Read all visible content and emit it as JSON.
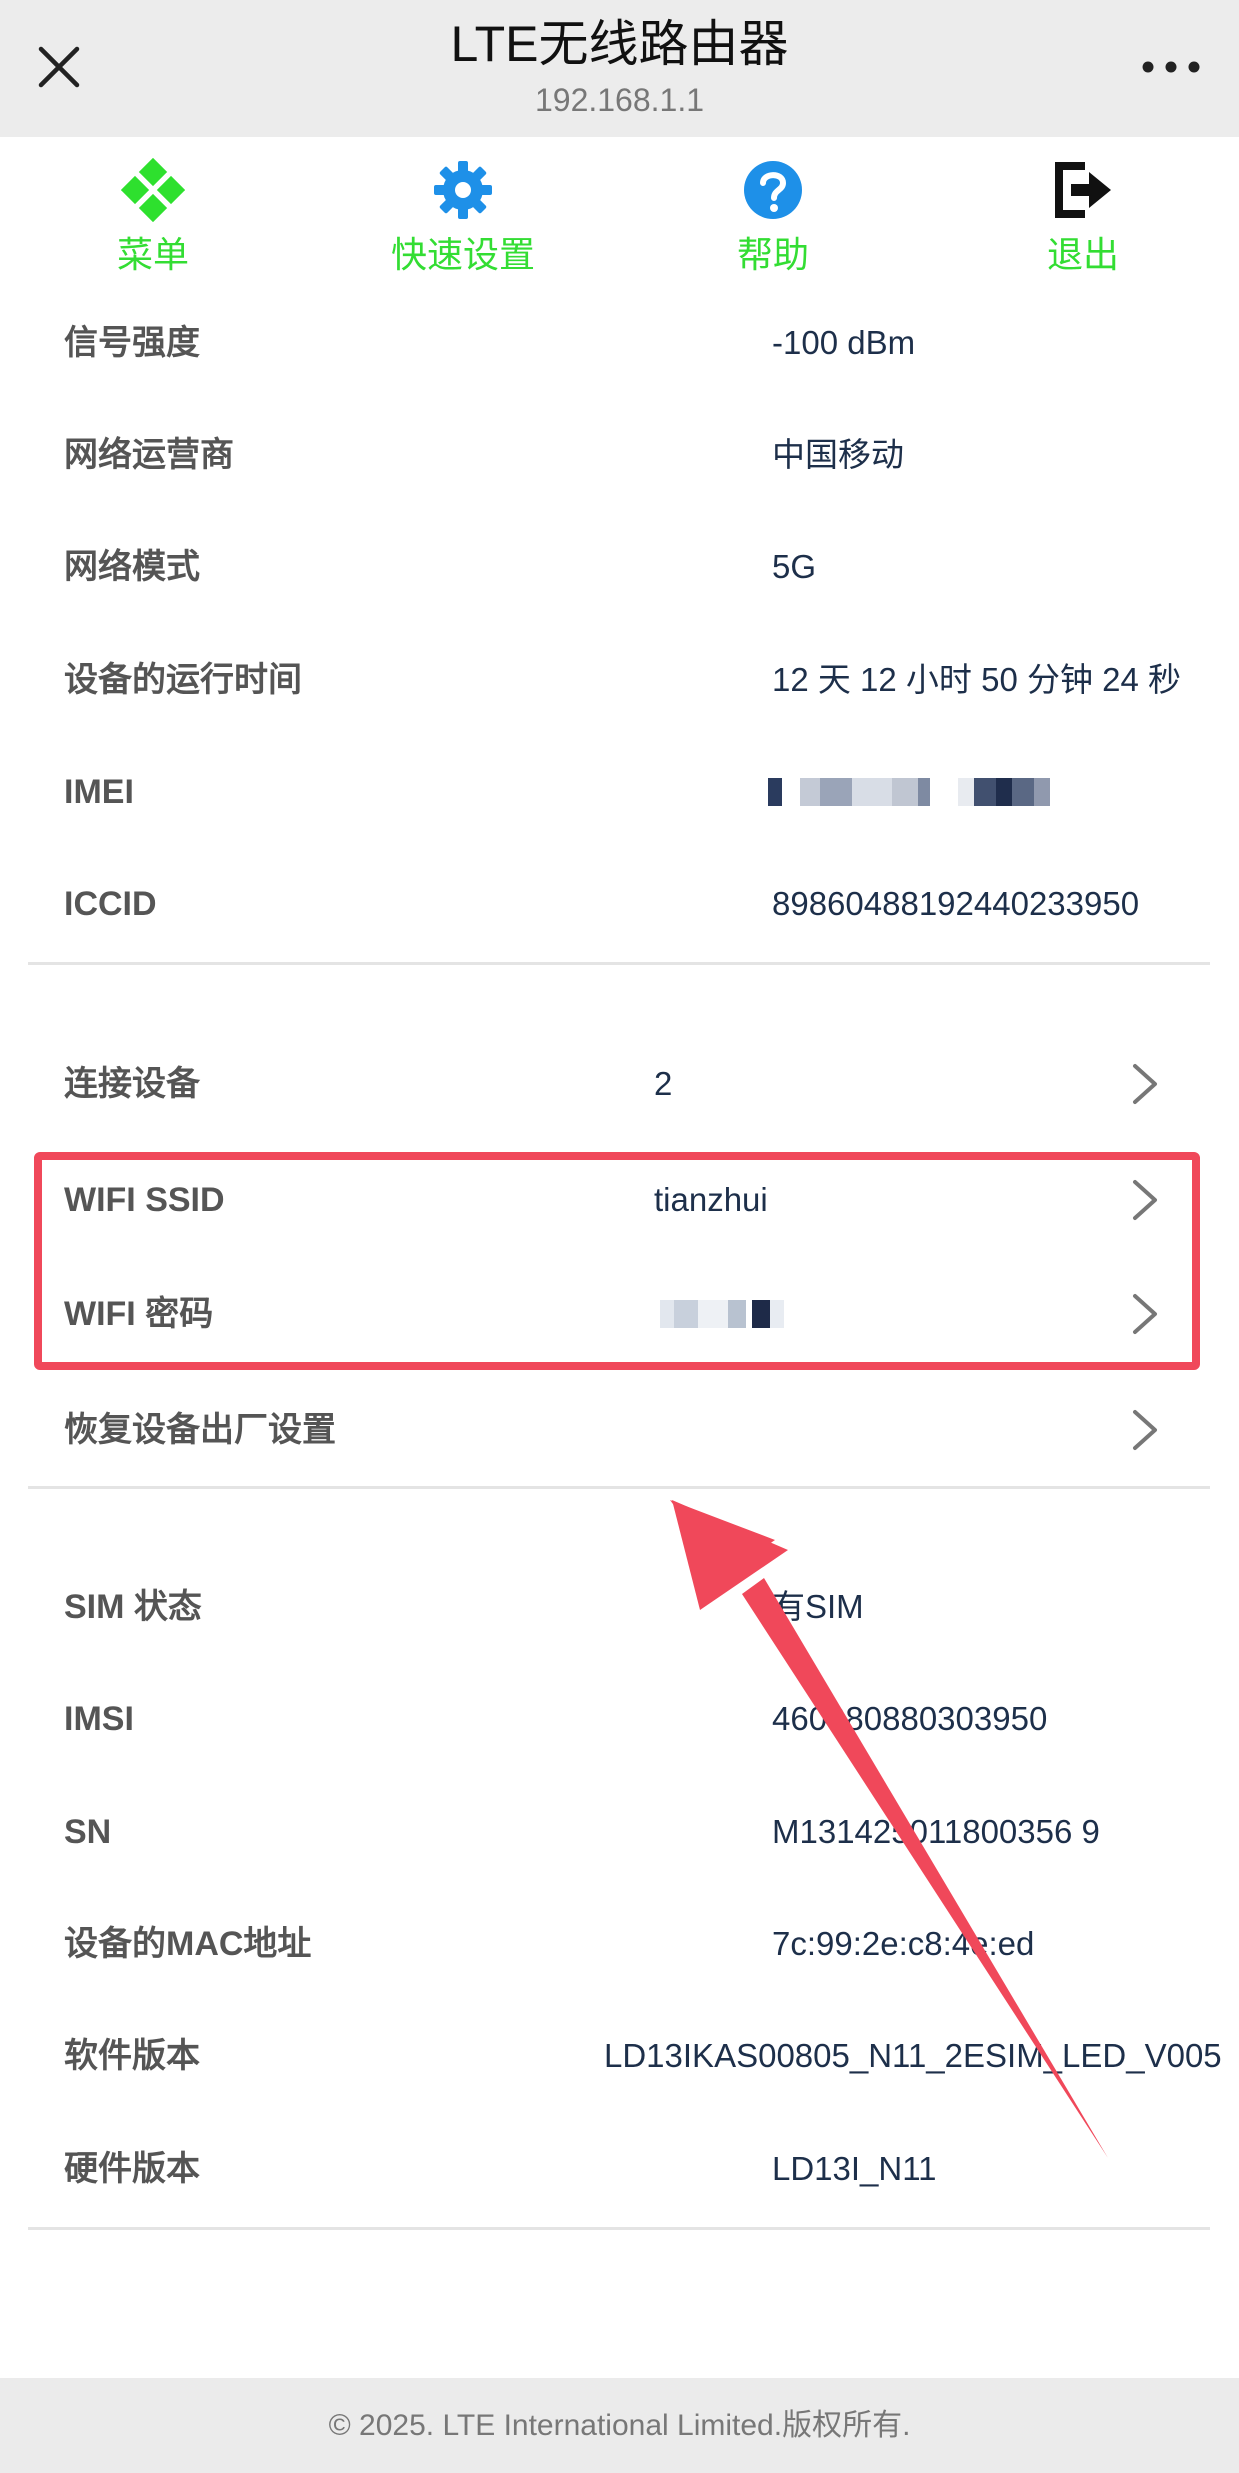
{
  "header": {
    "title": "LTE无线路由器",
    "subtitle": "192.168.1.1"
  },
  "nav": [
    {
      "label": "菜单",
      "icon": "diamond-grid-icon"
    },
    {
      "label": "快速设置",
      "icon": "gear-icon"
    },
    {
      "label": "帮助",
      "icon": "help-icon"
    },
    {
      "label": "退出",
      "icon": "logout-icon"
    }
  ],
  "status": {
    "signal_label": "信号强度",
    "signal_value": "-100 dBm",
    "operator_label": "网络运营商",
    "operator_value": "中国移动",
    "mode_label": "网络模式",
    "mode_value": "5G",
    "uptime_label": "设备的运行时间",
    "uptime_value": "12 天 12 小时 50 分钟 24 秒",
    "imei_label": "IMEI",
    "iccid_label": "ICCID",
    "iccid_value": "89860488192440233950"
  },
  "settings": {
    "devices_label": "连接设备",
    "devices_value": "2",
    "ssid_label": "WIFI SSID",
    "ssid_value": "tianzhui",
    "password_label": "WIFI 密码",
    "reset_label": "恢复设备出厂设置"
  },
  "info": {
    "sim_label": "SIM 状态",
    "sim_value": "有SIM",
    "imsi_label": "IMSI",
    "imsi_value": "460080880303950",
    "sn_label": "SN",
    "sn_value": "M131425011800356 9",
    "mac_label": "设备的MAC地址",
    "mac_value": "7c:99:2e:c8:4e:ed",
    "sw_label": "软件版本",
    "sw_value": "LD13IKAS00805_N11_2ESIM_LED_V005",
    "hw_label": "硬件版本",
    "hw_value": "LD13I_N11"
  },
  "footer": {
    "text": "© 2025. LTE International Limited.版权所有."
  },
  "colors": {
    "accent": "#33dd33",
    "highlight": "#f0485a",
    "value_text": "#1d2f4a"
  }
}
